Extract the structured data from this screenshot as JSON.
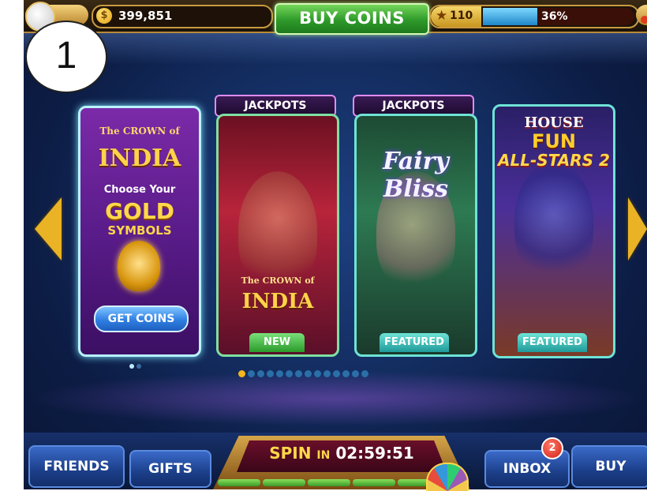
{
  "step_badge": "1",
  "topbar": {
    "coins": "399,851",
    "buy_coins_label": "BUY COINS",
    "level": "110",
    "xp_percent_label": "36%",
    "xp_fraction": 0.36,
    "avatar_icon": "profile-avatar",
    "coin_icon_glyph": "$",
    "star_glyph": "★"
  },
  "carousel": {
    "promo_card": {
      "title_top": "The CROWN of",
      "title_main": "INDIA",
      "choose": "Choose Your",
      "gold": "GOLD",
      "symbols": "SYMBOLS",
      "button": "GET COINS"
    },
    "games": [
      {
        "tab": "JACKPOTS",
        "title_small": "The CROWN of",
        "title": "INDIA",
        "ribbon": "NEW"
      },
      {
        "tab": "JACKPOTS",
        "title": "Fairy Bliss",
        "ribbon": "FEATURED"
      },
      {
        "title_1": "HOUSE",
        "title_2": "FUN",
        "title_3": "ALL-STARS 2",
        "ribbon": "FEATURED"
      }
    ],
    "page_count": 14,
    "active_page": 0
  },
  "bottombar": {
    "friends": "FRIENDS",
    "gifts": "GIFTS",
    "spin_word": "SPIN",
    "spin_in": "IN",
    "spin_timer": "02:59:51",
    "inbox": "INBOX",
    "inbox_badge": "2",
    "buy": "BUY"
  },
  "colors": {
    "buy_coins_green": "#2e9a2a",
    "accent_gold": "#e9b325",
    "frame_teal": "#2fd0c8",
    "pager_active": "#f2b51a",
    "pager_inactive": "#2a6fa8"
  }
}
